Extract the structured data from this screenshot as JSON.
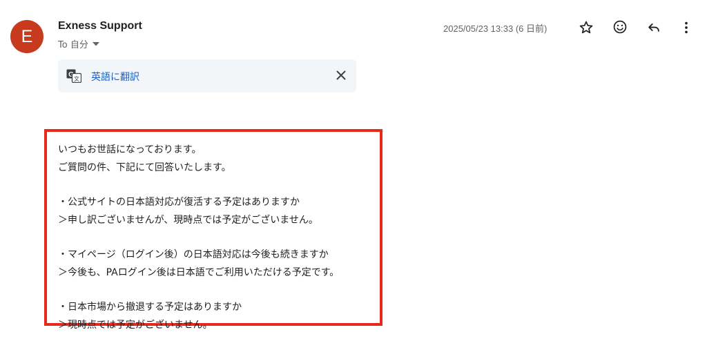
{
  "sender": {
    "avatar_letter": "E",
    "avatar_color": "#c73a1d",
    "name": "Exness Support",
    "recipient_label": "To 自分"
  },
  "header": {
    "timestamp": "2025/05/23 13:33 (6 日前)",
    "icons": [
      "star-icon",
      "emoji-icon",
      "reply-icon",
      "more-vert-icon"
    ]
  },
  "translate_bar": {
    "icon": "translate-icon",
    "link_label": "英語に翻訳",
    "close_icon": "close-icon",
    "link_color": "#1a5fc7",
    "background": "#f3f6f9"
  },
  "highlight_color": "#e8281a",
  "message": {
    "paragraphs": [
      [
        "いつもお世話になっております。",
        "ご質問の件、下記にて回答いたします。"
      ],
      [
        "・公式サイトの日本語対応が復活する予定はありますか",
        "＞申し訳ございませんが、現時点では予定がございません。"
      ],
      [
        "・マイページ（ログイン後）の日本語対応は今後も続きますか",
        "＞今後も、PAログイン後は日本語でご利用いただける予定です。"
      ],
      [
        "・日本市場から撤退する予定はありますか",
        "＞現時点では予定がございません。"
      ]
    ]
  }
}
